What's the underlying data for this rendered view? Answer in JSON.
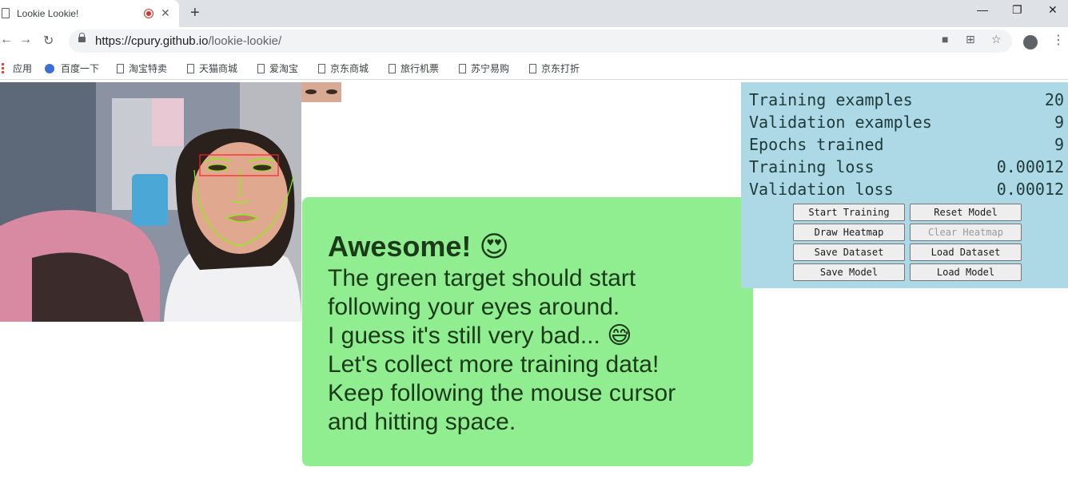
{
  "browser": {
    "tab_title": "Lookie Lookie!",
    "url_host": "https://cpury.github.io",
    "url_path": "/lookie-lookie/",
    "bookmarks": [
      "应用",
      "百度一下",
      "淘宝特卖",
      "天猫商城",
      "爱淘宝",
      "京东商城",
      "旅行机票",
      "苏宁易购",
      "京东打折"
    ]
  },
  "info": {
    "title": "Awesome! 😍",
    "lines": [
      "The green target should start",
      "following your eyes around.",
      "I guess it's still very bad... 😅",
      "Let's collect more training data!",
      "Keep following the mouse cursor",
      "and hitting space."
    ]
  },
  "stats": [
    {
      "label": "Training examples",
      "value": "20"
    },
    {
      "label": "Validation examples",
      "value": "9"
    },
    {
      "label": "Epochs trained",
      "value": "9"
    },
    {
      "label": "Training loss",
      "value": "0.00012"
    },
    {
      "label": "Validation loss",
      "value": "0.00012"
    }
  ],
  "buttons": {
    "start_training": "Start Training",
    "reset_model": "Reset Model",
    "draw_heatmap": "Draw Heatmap",
    "clear_heatmap": "Clear Heatmap",
    "save_dataset": "Save Dataset",
    "load_dataset": "Load Dataset",
    "save_model": "Save Model",
    "load_model": "Load Model"
  },
  "colors": {
    "info_bg": "#90ee90",
    "panel_bg": "#add8e6",
    "face_mesh": "#7cfc00",
    "eye_box": "#ff2020"
  }
}
